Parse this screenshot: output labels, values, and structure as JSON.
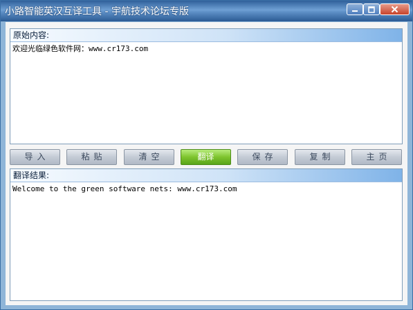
{
  "window": {
    "title": "小路智能英汉互译工具 - 宇航技术论坛专版"
  },
  "source_panel": {
    "header": "原始内容:",
    "text": "欢迎光临绿色软件网：www.cr173.com"
  },
  "buttons": {
    "import": "导入",
    "paste": "粘贴",
    "clear": "清空",
    "translate": "翻译",
    "save": "保存",
    "copy": "复制",
    "home": "主页"
  },
  "result_panel": {
    "header": "翻译结果:",
    "text": "Welcome to the green software nets: www.cr173.com"
  }
}
